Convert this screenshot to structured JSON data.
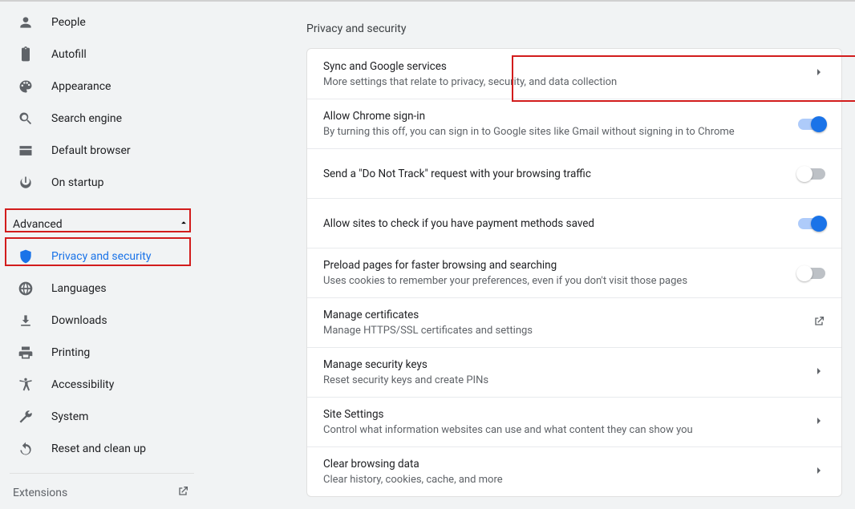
{
  "sidebar": {
    "basic": [
      {
        "id": "people",
        "label": "People",
        "icon": "person"
      },
      {
        "id": "autofill",
        "label": "Autofill",
        "icon": "clipboard"
      },
      {
        "id": "appearance",
        "label": "Appearance",
        "icon": "palette"
      },
      {
        "id": "search-engine",
        "label": "Search engine",
        "icon": "search"
      },
      {
        "id": "default-browser",
        "label": "Default browser",
        "icon": "browser"
      },
      {
        "id": "on-startup",
        "label": "On startup",
        "icon": "power"
      }
    ],
    "advanced_label": "Advanced",
    "advanced_expanded": true,
    "advanced": [
      {
        "id": "privacy",
        "label": "Privacy and security",
        "icon": "shield",
        "selected": true
      },
      {
        "id": "languages",
        "label": "Languages",
        "icon": "globe"
      },
      {
        "id": "downloads",
        "label": "Downloads",
        "icon": "download"
      },
      {
        "id": "printing",
        "label": "Printing",
        "icon": "print"
      },
      {
        "id": "accessibility",
        "label": "Accessibility",
        "icon": "accessibility"
      },
      {
        "id": "system",
        "label": "System",
        "icon": "wrench"
      },
      {
        "id": "reset",
        "label": "Reset and clean up",
        "icon": "restore"
      }
    ],
    "extensions_label": "Extensions"
  },
  "main": {
    "section_title": "Privacy and security",
    "rows": [
      {
        "id": "sync",
        "title": "Sync and Google services",
        "subtitle": "More settings that relate to privacy, security, and data collection",
        "action": "chevron"
      },
      {
        "id": "signin",
        "title": "Allow Chrome sign-in",
        "subtitle": "By turning this off, you can sign in to Google sites like Gmail without signing in to Chrome",
        "action": "toggle",
        "value": true
      },
      {
        "id": "dnt",
        "title": "Send a \"Do Not Track\" request with your browsing traffic",
        "action": "toggle",
        "value": false
      },
      {
        "id": "payments",
        "title": "Allow sites to check if you have payment methods saved",
        "action": "toggle",
        "value": true
      },
      {
        "id": "preload",
        "title": "Preload pages for faster browsing and searching",
        "subtitle": "Uses cookies to remember your preferences, even if you don't visit those pages",
        "action": "toggle",
        "value": false
      },
      {
        "id": "certs",
        "title": "Manage certificates",
        "subtitle": "Manage HTTPS/SSL certificates and settings",
        "action": "launch"
      },
      {
        "id": "seckeys",
        "title": "Manage security keys",
        "subtitle": "Reset security keys and create PINs",
        "action": "chevron"
      },
      {
        "id": "sitesettings",
        "title": "Site Settings",
        "subtitle": "Control what information websites can use and what content they can show you",
        "action": "chevron"
      },
      {
        "id": "clear",
        "title": "Clear browsing data",
        "subtitle": "Clear history, cookies, cache, and more",
        "action": "chevron"
      }
    ]
  }
}
